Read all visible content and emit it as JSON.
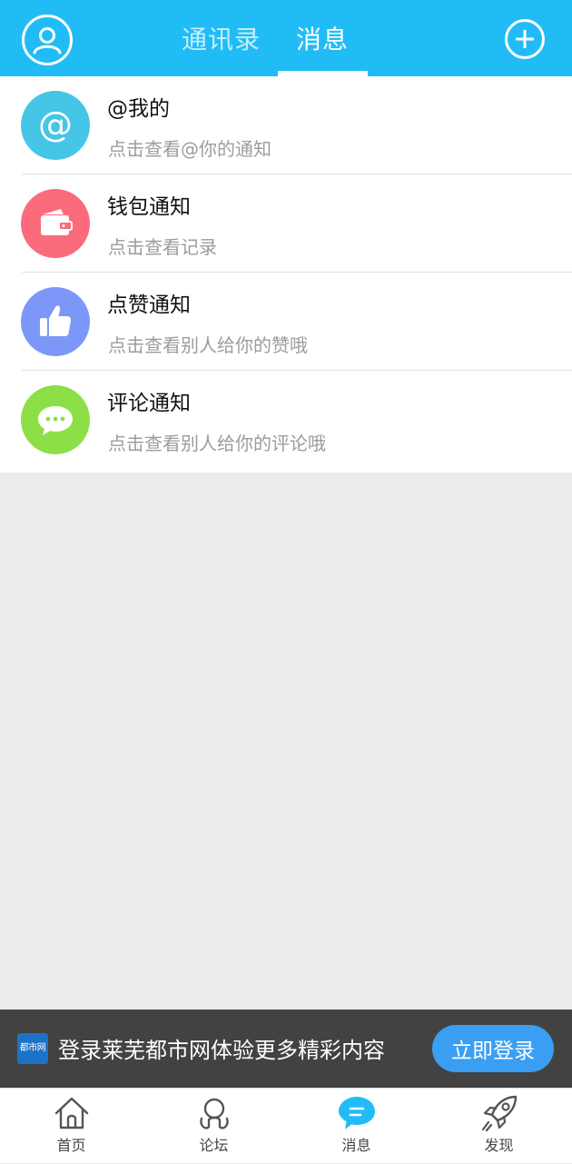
{
  "header": {
    "tabs": [
      {
        "label": "通讯录"
      },
      {
        "label": "消息"
      }
    ],
    "active_tab": "消息",
    "colors": {
      "bg": "#21bcf5",
      "active": "#ffffff",
      "inactive": "#c9ecfb"
    }
  },
  "messages": {
    "items": [
      {
        "title": "@我的",
        "subtitle": "点击查看@你的通知",
        "icon": "at-icon",
        "color": "#45c6e6"
      },
      {
        "title": "钱包通知",
        "subtitle": "点击查看记录",
        "icon": "wallet-icon",
        "color": "#fa6b7c"
      },
      {
        "title": "点赞通知",
        "subtitle": "点击查看别人给你的赞哦",
        "icon": "thumbs-up-icon",
        "color": "#7d97f8"
      },
      {
        "title": "评论通知",
        "subtitle": "点击查看别人给你的评论哦",
        "icon": "comment-icon",
        "color": "#8cdf47"
      }
    ]
  },
  "banner": {
    "logo_text": "都市网",
    "text": "登录莱芜都市网体验更多精彩内容",
    "button": "立即登录"
  },
  "bottom_nav": {
    "items": [
      {
        "label": "首页",
        "icon": "home-icon"
      },
      {
        "label": "论坛",
        "icon": "forum-icon"
      },
      {
        "label": "消息",
        "icon": "message-icon"
      },
      {
        "label": "发现",
        "icon": "rocket-icon"
      }
    ],
    "active": "消息"
  }
}
